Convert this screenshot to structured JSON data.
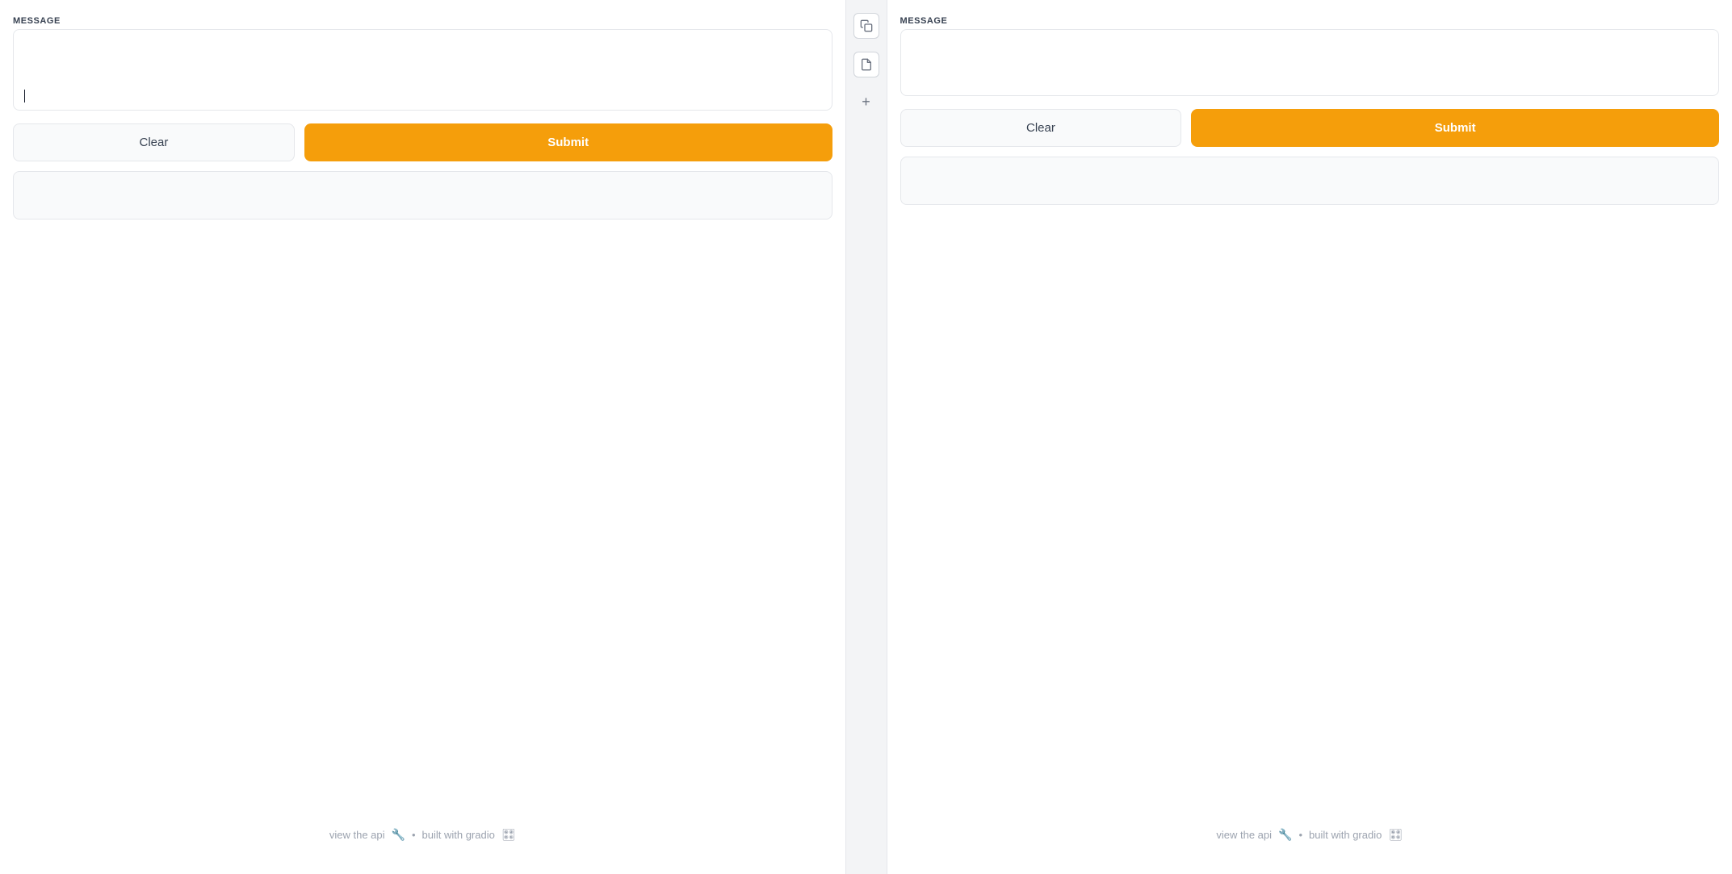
{
  "left_panel": {
    "message_label": "MESSAGE",
    "message_placeholder": "",
    "clear_label": "Clear",
    "submit_label": "Submit"
  },
  "right_panel": {
    "message_label": "MESSAGE",
    "message_placeholder": "",
    "clear_label": "Clear",
    "submit_label": "Submit"
  },
  "footer": {
    "api_link_text": "view the api",
    "separator": "•",
    "built_with_text": "built with gradio",
    "wrench_icon": "🔧",
    "gradio_icon": "🎛"
  },
  "divider": {
    "copy_icon": "⧉",
    "file_icon": "📄",
    "plus_icon": "+"
  }
}
